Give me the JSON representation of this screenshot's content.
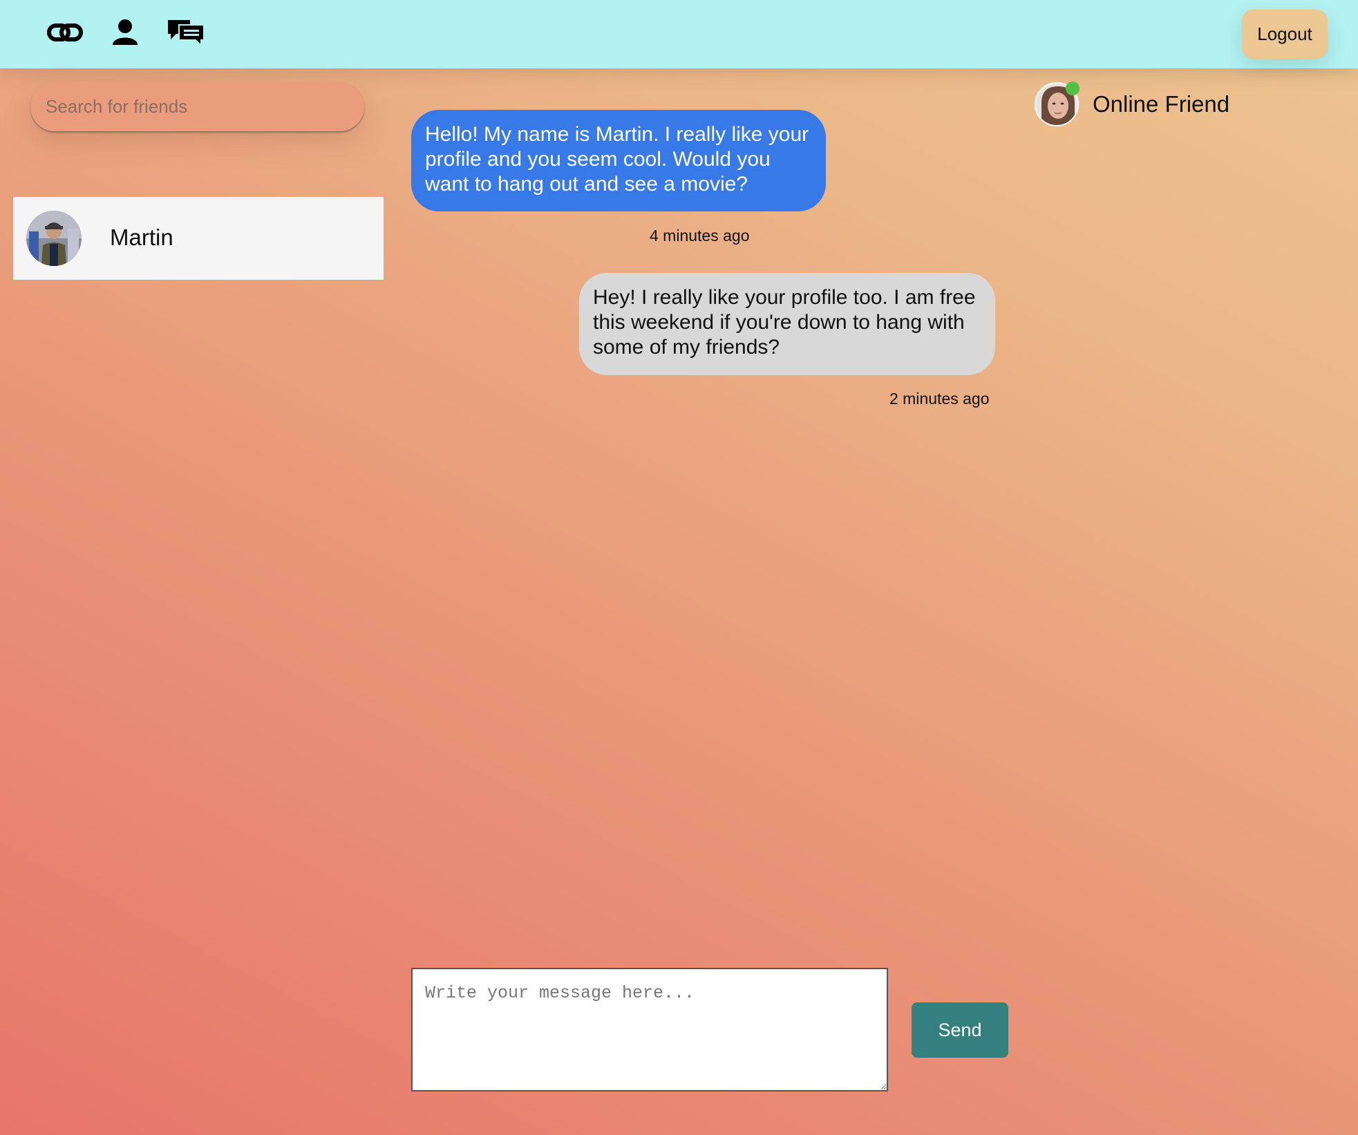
{
  "nav": {
    "icons": [
      "link-icon",
      "user-icon",
      "chat-icon"
    ],
    "logout_label": "Logout"
  },
  "search": {
    "placeholder": "Search for friends"
  },
  "friends": [
    {
      "name": "Martin"
    }
  ],
  "online_friend": {
    "label": "Online Friend",
    "status_color": "#52c045"
  },
  "messages": [
    {
      "direction": "sent",
      "text": "Hello! My name is Martin. I really like your profile and you seem cool. Would you want to hang out and see a movie?",
      "time": "4 minutes ago"
    },
    {
      "direction": "received",
      "text": "Hey! I really like your profile too. I am free this weekend if you're down to hang with some of my friends?",
      "time": "2 minutes ago"
    }
  ],
  "composer": {
    "placeholder": "Write your message here...",
    "send_label": "Send"
  },
  "colors": {
    "topbar": "#b2f2f1",
    "sent_bubble": "#3879e8",
    "received_bubble": "#d8d8d8",
    "send_button": "#34807e",
    "logout_button": "#edc792"
  }
}
